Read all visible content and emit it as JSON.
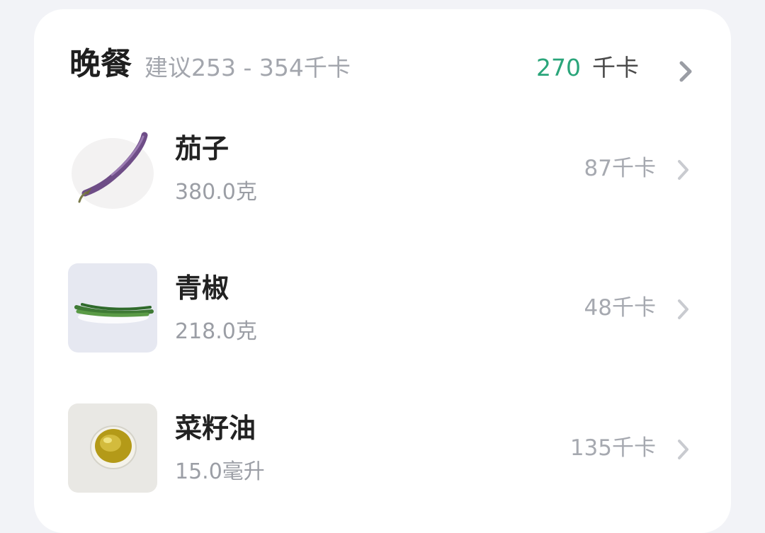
{
  "meal": {
    "title": "晚餐",
    "suggestion": "建议253 - 354千卡",
    "total_kcal": "270",
    "total_unit": "千卡",
    "chevron_icon": "chevron-right-icon"
  },
  "colors": {
    "accent_green": "#2aa57a",
    "muted_text": "#a3a6ad",
    "background": "#f2f3f7"
  },
  "foods": [
    {
      "name": "茄子",
      "amount": "380.0克",
      "kcal": "87千卡",
      "image": "eggplant-photo"
    },
    {
      "name": "青椒",
      "amount": "218.0克",
      "kcal": "48千卡",
      "image": "green-pepper-photo"
    },
    {
      "name": "菜籽油",
      "amount": "15.0毫升",
      "kcal": "135千卡",
      "image": "rapeseed-oil-photo"
    }
  ]
}
